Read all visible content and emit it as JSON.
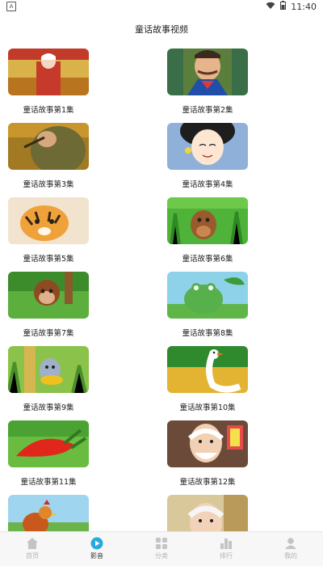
{
  "status": {
    "time": "11:40",
    "app_badge": "A"
  },
  "header": {
    "title": "童话故事视频"
  },
  "videos": [
    {
      "title": "童话故事第1集"
    },
    {
      "title": "童话故事第2集"
    },
    {
      "title": "童话故事第3集"
    },
    {
      "title": "童话故事第4集"
    },
    {
      "title": "童话故事第5集"
    },
    {
      "title": "童话故事第6集"
    },
    {
      "title": "童话故事第7集"
    },
    {
      "title": "童话故事第8集"
    },
    {
      "title": "童话故事第9集"
    },
    {
      "title": "童话故事第10集"
    },
    {
      "title": "童话故事第11集"
    },
    {
      "title": "童话故事第12集"
    },
    {
      "title": ""
    },
    {
      "title": ""
    }
  ],
  "nav": [
    {
      "label": "首页",
      "icon": "home-icon"
    },
    {
      "label": "影音",
      "icon": "play-icon",
      "active": true
    },
    {
      "label": "分类",
      "icon": "grid-icon"
    },
    {
      "label": "排行",
      "icon": "bar-chart-icon"
    },
    {
      "label": "我的",
      "icon": "person-icon"
    }
  ],
  "colors": {
    "accent": "#29a8e0",
    "nav_inactive": "#b3b3b3",
    "nav_bg": "#f7f7f7"
  }
}
